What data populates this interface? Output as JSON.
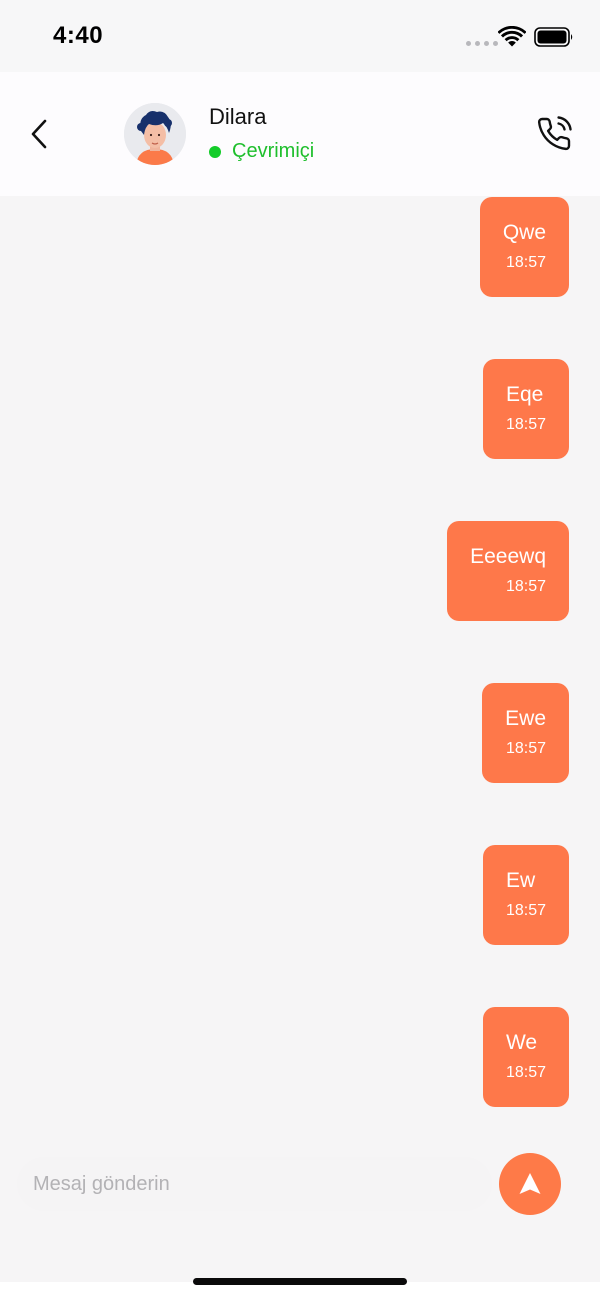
{
  "status_bar": {
    "time": "4:40"
  },
  "header": {
    "contact_name": "Dilara",
    "presence": "Çevrimiçi",
    "presence_color": "#14cc2a"
  },
  "messages": [
    {
      "text": "Qwe",
      "time": "18:57",
      "direction": "outgoing"
    },
    {
      "text": "Eqe",
      "time": "18:57",
      "direction": "outgoing"
    },
    {
      "text": "Eeeewq",
      "time": "18:57",
      "direction": "outgoing"
    },
    {
      "text": "Ewe",
      "time": "18:57",
      "direction": "outgoing"
    },
    {
      "text": "Ew",
      "time": "18:57",
      "direction": "outgoing"
    },
    {
      "text": "We",
      "time": "18:57",
      "direction": "outgoing"
    }
  ],
  "composer": {
    "placeholder": "Mesaj gönderin",
    "value": ""
  },
  "colors": {
    "accent": "#fe784a",
    "background": "#f6f5f6",
    "online": "#14cc2a"
  },
  "icons": {
    "back": "chevron-left-icon",
    "call": "phone-call-icon",
    "send": "send-icon"
  }
}
